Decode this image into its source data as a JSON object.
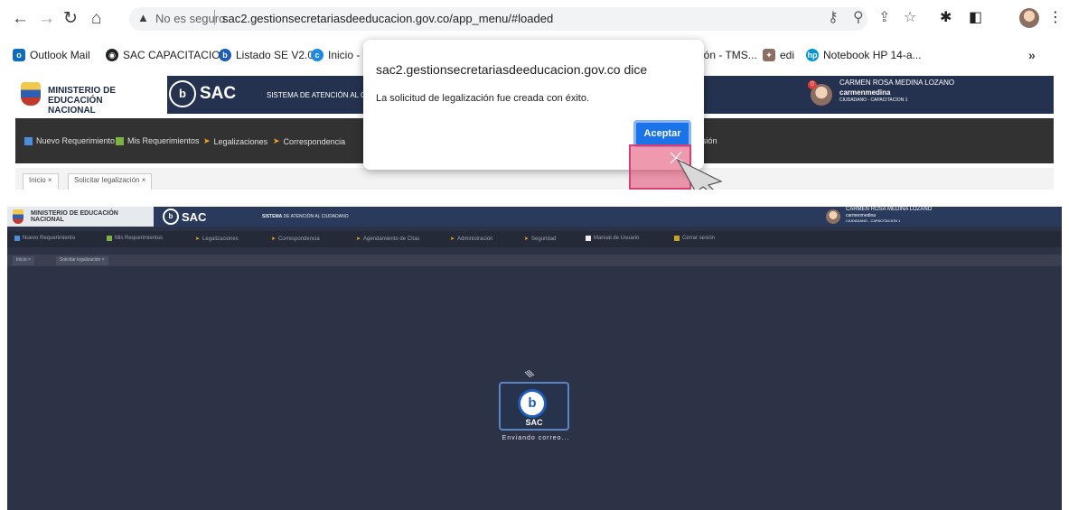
{
  "browser": {
    "security_label": "No es seguro",
    "url": "sac2.gestionsecretariasdeeducacion.gov.co/app_menu/#loaded",
    "bookmarks": [
      {
        "label": "Outlook Mail",
        "color": "#0f6cbd"
      },
      {
        "label": "SAC CAPACITACIO...",
        "color": "#202124"
      },
      {
        "label": "Listado SE V2.0",
        "color": "#1c5bb6"
      },
      {
        "label": "Inicio - C",
        "color": "#1e88e5"
      },
      {
        "label": "ión - TMS...",
        "color": "#4caf50"
      },
      {
        "label": "edi",
        "color": "#8d6e63"
      },
      {
        "label": "Notebook HP 14-a...",
        "color": "#0096d6"
      }
    ],
    "more_label": "»"
  },
  "app": {
    "ministry_line1": "MINISTERIO DE EDUCACIÓN",
    "ministry_line2": "NACIONAL",
    "brand": "SAC",
    "system_title_bold": "SISTEMA",
    "system_title_rest": " DE ATENCIÓN AL CIUDADANO",
    "system_title_top_visible": "SISTEMA DE ATENCIÓN AL CIUDA",
    "user": {
      "name": "CARMEN ROSA MEDINA LOZANO",
      "login": "carmenmedina",
      "role": "CIUDADANO - CAPACITACION 1",
      "notification_count": "0"
    },
    "menu_top": [
      {
        "label": "Nuevo Requerimiento",
        "color": "#4a90d9"
      },
      {
        "label": "Mis Requerimientos",
        "color": "#7cb342"
      },
      {
        "label": "Legalizaciones",
        "color": "#f6a623"
      },
      {
        "label": "Correspondencia",
        "color": "#f6a623"
      },
      {
        "label": "sión",
        "color": "#9e9e9e"
      }
    ],
    "menu_bottom": [
      {
        "label": "Nuevo Requerimiento",
        "color": "#4a90d9"
      },
      {
        "label": "Mis Requerimientos",
        "color": "#7cb342"
      },
      {
        "label": "Legalizaciones",
        "color": "#f6a623"
      },
      {
        "label": "Correspondencia",
        "color": "#f6a623"
      },
      {
        "label": "Agendamiento de Citas",
        "color": "#f6a623"
      },
      {
        "label": "Administración",
        "color": "#f6a623"
      },
      {
        "label": "Seguridad",
        "color": "#f6a623"
      },
      {
        "label": "Manual de Usuario",
        "color": "#eeeeee"
      },
      {
        "label": "Cerrar sesión",
        "color": "#c9a227"
      }
    ],
    "tabs_top": [
      "Inicio ×",
      "Solicitar legalización ×"
    ],
    "tabs_bottom": [
      "Inicio ×",
      "Solicitar legalización ×"
    ]
  },
  "dialog": {
    "origin": "sac2.gestionsecretariasdeeducacion.gov.co dice",
    "message": "La solicitud de legalización fue creada con éxito.",
    "accept_label": "Aceptar"
  },
  "loading": {
    "brand": "SAC",
    "message": "Enviando correo..."
  }
}
